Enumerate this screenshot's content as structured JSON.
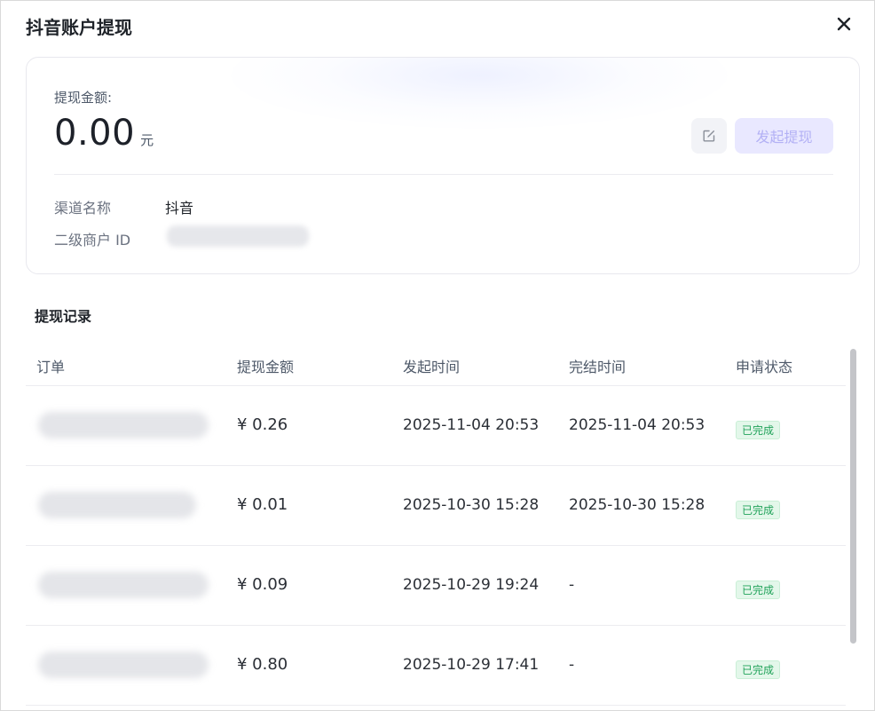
{
  "dialog": {
    "title": "抖音账户提现"
  },
  "summary": {
    "amount_label": "提现金额:",
    "amount_value": "0.00",
    "amount_unit": "元",
    "withdraw_button": "发起提现",
    "channel_label": "渠道名称",
    "channel_value": "抖音",
    "merchant_label": "二级商户 ID"
  },
  "records": {
    "title": "提现记录",
    "columns": [
      "订单",
      "提现金额",
      "发起时间",
      "完结时间",
      "申请状态"
    ],
    "rows": [
      {
        "amount": "¥ 0.26",
        "start": "2025-11-04 20:53",
        "end": "2025-11-04 20:53",
        "status": "已完成"
      },
      {
        "amount": "¥ 0.01",
        "start": "2025-10-30 15:28",
        "end": "2025-10-30 15:28",
        "status": "已完成"
      },
      {
        "amount": "¥ 0.09",
        "start": "2025-10-29 19:24",
        "end": "-",
        "status": "已完成"
      },
      {
        "amount": "¥ 0.80",
        "start": "2025-10-29 17:41",
        "end": "-",
        "status": "已完成"
      }
    ]
  },
  "icons": {
    "close": "close-icon",
    "edit": "edit-icon"
  },
  "colors": {
    "accent_disabled_bg": "#e9e8ff",
    "accent_disabled_text": "#b3b1f5",
    "status_success": "#21a35a"
  }
}
